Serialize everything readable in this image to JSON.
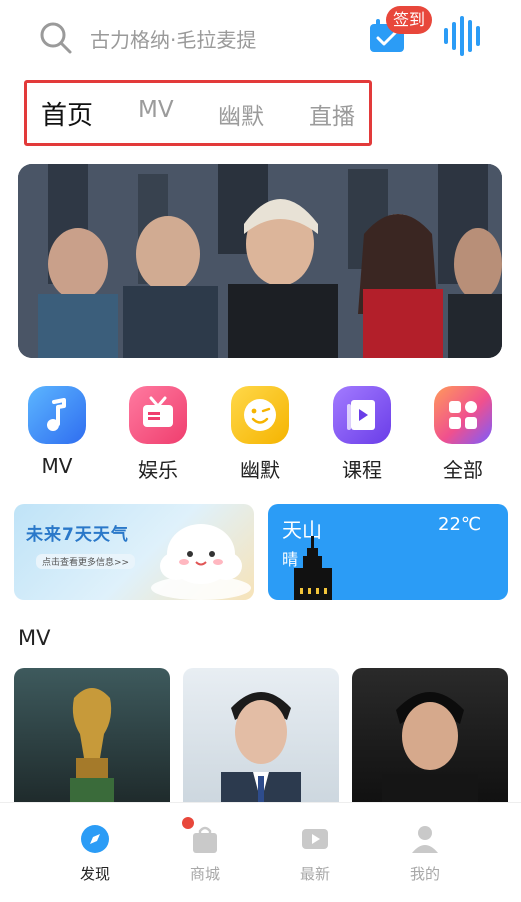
{
  "header": {
    "search_placeholder": "古力格纳·毛拉麦提",
    "checkin_label": "签到",
    "icons": {
      "search": "search-icon",
      "checkin": "calendar-check-icon",
      "voice": "voice-wave-icon"
    }
  },
  "tabs": [
    {
      "label": "首页",
      "active": true
    },
    {
      "label": "MV",
      "active": false
    },
    {
      "label": "幽默",
      "active": false
    },
    {
      "label": "直播",
      "active": false
    }
  ],
  "categories": [
    {
      "label": "MV",
      "icon": "music-note-icon",
      "color": "#3a8ef6"
    },
    {
      "label": "娱乐",
      "icon": "tv-icon",
      "color": "#f24d7c"
    },
    {
      "label": "幽默",
      "icon": "wink-face-icon",
      "color": "#f7c413"
    },
    {
      "label": "课程",
      "icon": "book-icon",
      "color": "#7b4ff0"
    },
    {
      "label": "全部",
      "icon": "grid-icon",
      "color": "#f05a8a"
    }
  ],
  "promo_left": {
    "title": "未来7天天气",
    "subtitle": "点击查看更多信息>>"
  },
  "promo_right": {
    "city": "天山",
    "temperature": "22℃",
    "condition": "晴"
  },
  "section": {
    "title": "MV"
  },
  "bottom_nav": [
    {
      "label": "发现",
      "icon": "compass-icon",
      "active": true
    },
    {
      "label": "商城",
      "icon": "shopping-bag-icon",
      "active": false,
      "badge": true
    },
    {
      "label": "最新",
      "icon": "play-icon",
      "active": false
    },
    {
      "label": "我的",
      "icon": "person-icon",
      "active": false
    }
  ],
  "colors": {
    "accent": "#2b9cf6",
    "badge": "#e8473b",
    "tab_border": "#e23a3a"
  }
}
